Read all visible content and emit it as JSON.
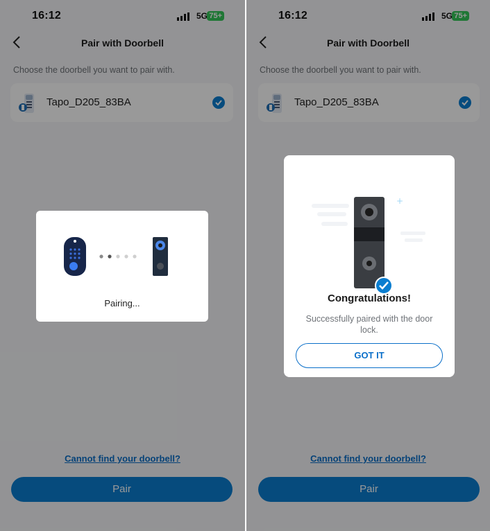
{
  "status": {
    "time": "16:12",
    "network": "5G",
    "battery": "75+"
  },
  "nav": {
    "title": "Pair with Doorbell"
  },
  "instruction": "Choose the doorbell you want to pair with.",
  "device": {
    "name": "Tapo_D205_83BA",
    "selected": true
  },
  "link": {
    "cannot_find": "Cannot find your doorbell?"
  },
  "button": {
    "pair": "Pair"
  },
  "pairing_dialog": {
    "text": "Pairing..."
  },
  "success_dialog": {
    "title": "Congratulations!",
    "message": "Successfully paired with the door lock.",
    "button": "GOT IT"
  },
  "colors": {
    "accent": "#0b7ed0",
    "battery": "#34c759"
  }
}
